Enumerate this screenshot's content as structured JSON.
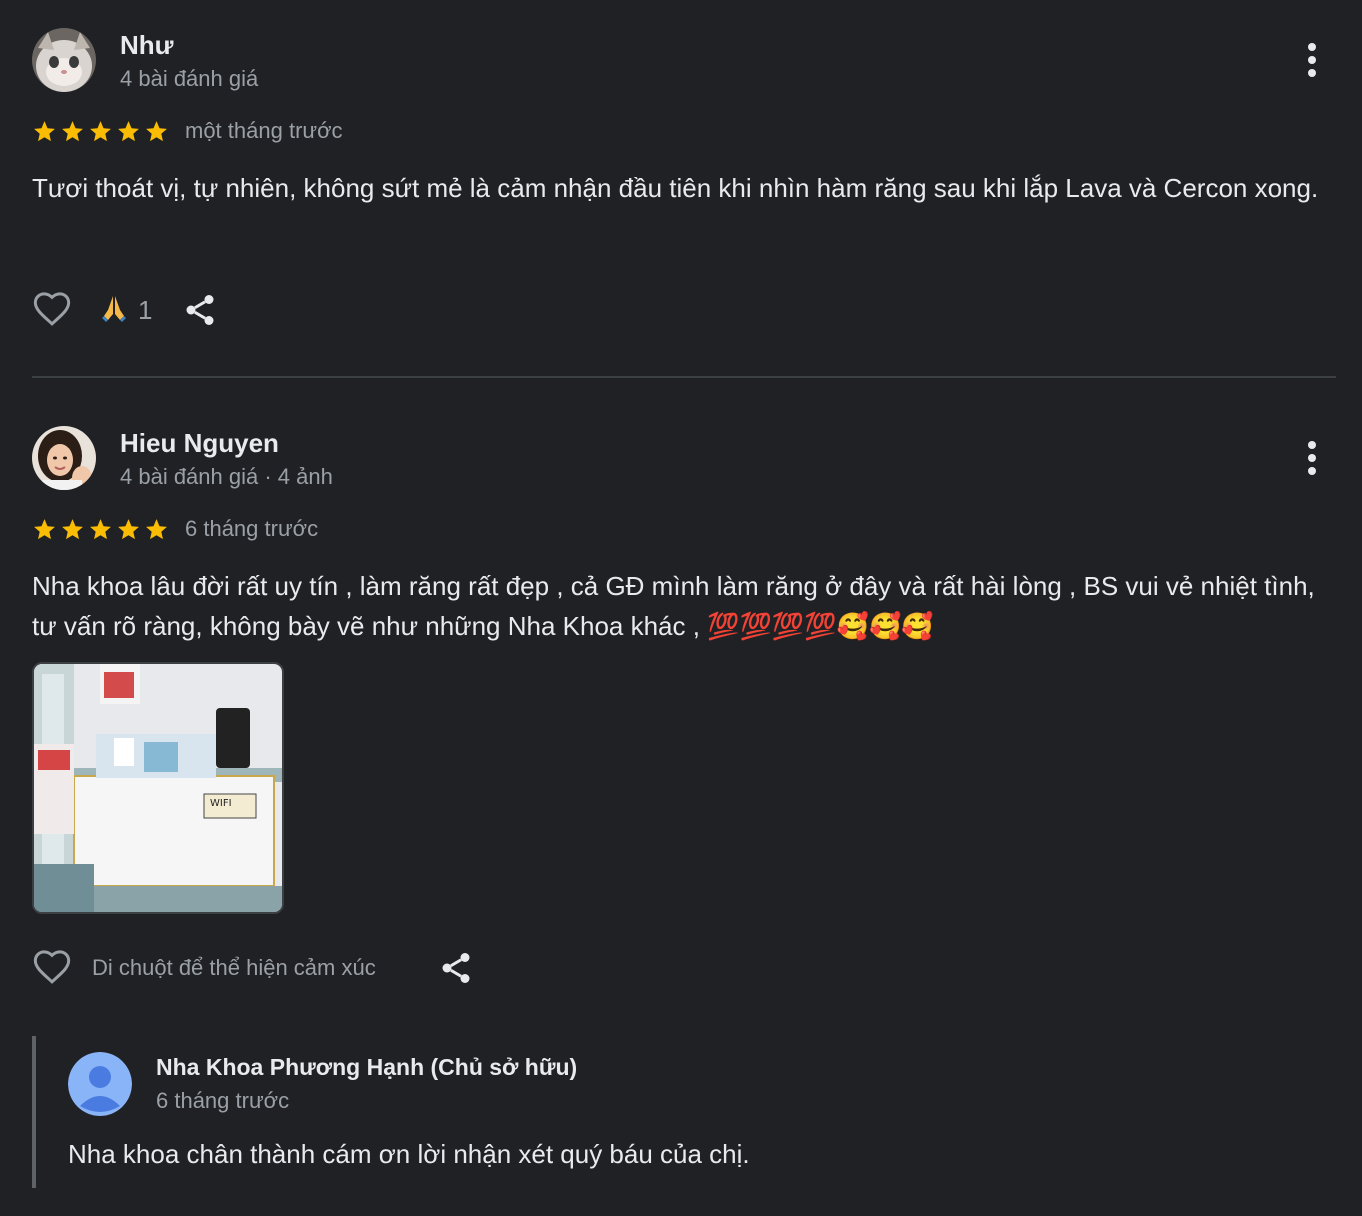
{
  "colors": {
    "background": "#202124",
    "text": "#e8eaed",
    "secondary": "#9aa0a6",
    "star": "#fbbc04",
    "divider": "#3c4043",
    "owner_avatar": "#8ab4f8"
  },
  "reviews": [
    {
      "author": "Như",
      "meta": "4 bài đánh giá",
      "rating": 5,
      "time": "một tháng trước",
      "text": "Tươi thoát vị, tự nhiên, không sứt mẻ là cảm nhận đầu tiên khi nhìn hàm răng sau khi lắp Lava và Cercon xong.",
      "reaction_emoji": "🙏",
      "reaction_count": "1",
      "icons": [
        "heart-icon",
        "pray-emoji-icon",
        "share-icon",
        "more-vert-icon"
      ]
    },
    {
      "author": "Hieu Nguyen",
      "meta": "4 bài đánh giá · 4 ảnh",
      "rating": 5,
      "time": "6 tháng trước",
      "text_main": "Nha khoa lâu đời rất uy tín , làm răng rất đẹp , cả GĐ mình làm răng ở đây và rất hài lòng , BS vui vẻ nhiệt tình, tư vấn rõ ràng, không bày vẽ như những Nha Khoa khác , ",
      "text_emoji": "💯💯💯💯🥰🥰🥰",
      "hover_hint": "Di chuột để thể hiện cảm xúc",
      "icons": [
        "heart-icon",
        "share-icon",
        "more-vert-icon"
      ]
    }
  ],
  "owner_reply": {
    "author": "Nha Khoa Phương Hạnh (Chủ sở hữu)",
    "time": "6 tháng trước",
    "text": "Nha khoa chân thành cám ơn lời nhận xét quý báu của chị.",
    "icon": "person-icon"
  }
}
